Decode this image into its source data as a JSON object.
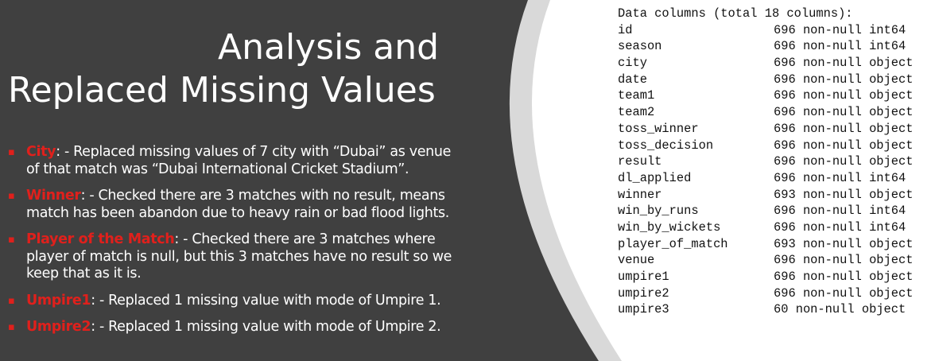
{
  "colors": {
    "background": "#404040",
    "accent": "#e0201c",
    "arc": "#d9d9d9",
    "panel": "#ffffff"
  },
  "slide": {
    "title_line1": "Analysis and",
    "title_line2": "Replaced Missing Values",
    "bullets": [
      {
        "key": "City",
        "text": ": - Replaced missing values of 7 city with “Dubai” as venue of that match was “Dubai International Cricket Stadium”."
      },
      {
        "key": "Winner",
        "text": ": - Checked there are 3 matches with no result, means match has been abandon due to heavy rain or bad flood lights."
      },
      {
        "key": "Player of the Match",
        "text": ": - Checked there are 3 matches where player of match is null, but this 3 matches have no result so we keep that as it is."
      },
      {
        "key": "Umpire1",
        "text": ": - Replaced 1 missing value with mode of Umpire 1."
      },
      {
        "key": "Umpire2",
        "text": ": - Replaced 1 missing value with mode of Umpire 2."
      }
    ]
  },
  "info": {
    "header": "Data columns (total 18 columns):",
    "columns": [
      {
        "name": "id",
        "stats": "696 non-null int64"
      },
      {
        "name": "season",
        "stats": "696 non-null int64"
      },
      {
        "name": "city",
        "stats": "696 non-null object"
      },
      {
        "name": "date",
        "stats": "696 non-null object"
      },
      {
        "name": "team1",
        "stats": "696 non-null object"
      },
      {
        "name": "team2",
        "stats": "696 non-null object"
      },
      {
        "name": "toss_winner",
        "stats": "696 non-null object"
      },
      {
        "name": "toss_decision",
        "stats": "696 non-null object"
      },
      {
        "name": "result",
        "stats": "696 non-null object"
      },
      {
        "name": "dl_applied",
        "stats": "696 non-null int64"
      },
      {
        "name": "winner",
        "stats": "693 non-null object"
      },
      {
        "name": "win_by_runs",
        "stats": "696 non-null int64"
      },
      {
        "name": "win_by_wickets",
        "stats": "696 non-null int64"
      },
      {
        "name": "player_of_match",
        "stats": "693 non-null object"
      },
      {
        "name": "venue",
        "stats": "696 non-null object"
      },
      {
        "name": "umpire1",
        "stats": "696 non-null object"
      },
      {
        "name": "umpire2",
        "stats": "696 non-null object"
      },
      {
        "name": "umpire3",
        "stats": "60 non-null object"
      }
    ]
  }
}
